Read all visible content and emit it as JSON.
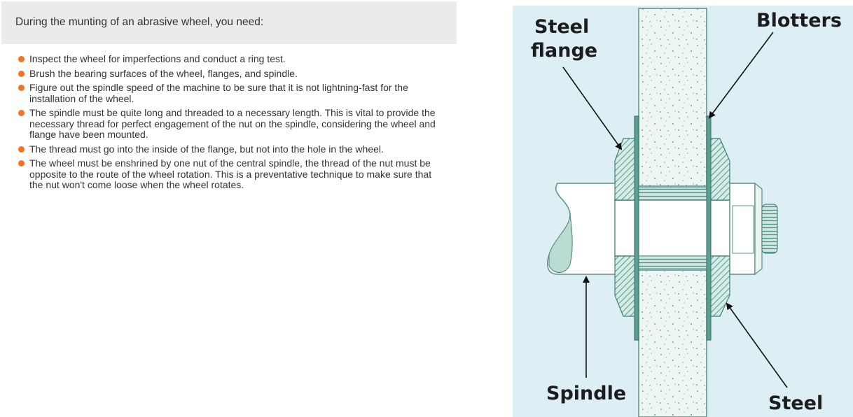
{
  "intro": "During the munting of an abrasive wheel, you need:",
  "items": [
    "Inspect the wheel for imperfections and conduct a ring test.",
    "Brush the bearing surfaces of the wheel, flanges, and spindle.",
    "Figure out the spindle speed of the machine to be sure that it is not lightning-fast for the installation of the wheel.",
    "The spindle must be quite long and threaded to a necessary length. This is vital to provide the necessary thread for perfect engagement of the nut on the spindle, considering the wheel and flange have been mounted.",
    "The thread must go into the inside of the flange, but not into the hole in the wheel.",
    "The wheel must be enshrined by one nut of the central spindle, the thread of the nut must be opposite to the route of the wheel rotation. This is a preventative technique to make sure that the nut won't come loose when the wheel rotates."
  ],
  "bullet_color": "#f07522",
  "diagram": {
    "background": "#deeef5",
    "labels": {
      "steel_flange_1": "Steel",
      "steel_flange_2": "flange",
      "blotters": "Blotters",
      "spindle": "Spindle",
      "steel": "Steel"
    }
  }
}
